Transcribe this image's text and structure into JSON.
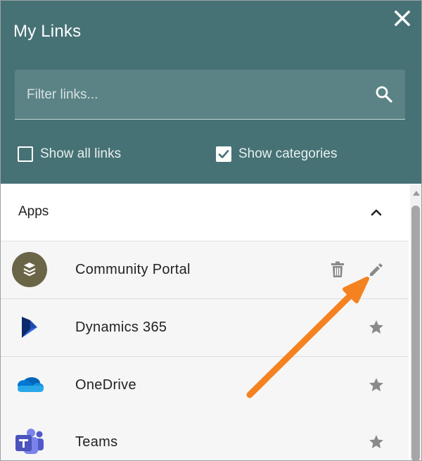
{
  "panel": {
    "title": "My Links",
    "close_icon": "close-icon",
    "header_color": "#467275"
  },
  "search": {
    "placeholder": "Filter links...",
    "value": "",
    "icon": "search-icon"
  },
  "options": {
    "show_all_links": {
      "label": "Show all links",
      "checked": false
    },
    "show_categories": {
      "label": "Show categories",
      "checked": true
    }
  },
  "category": {
    "label": "Apps",
    "expanded": true,
    "chevron_icon": "chevron-up-icon"
  },
  "links": [
    {
      "name": "Community Portal",
      "icon": "layers-icon",
      "actions": [
        "trash-icon",
        "pencil-icon"
      ]
    },
    {
      "name": "Dynamics 365",
      "icon": "dynamics-365-icon",
      "actions": [
        "star-icon"
      ]
    },
    {
      "name": "OneDrive",
      "icon": "onedrive-cloud-icon",
      "actions": [
        "star-icon"
      ]
    },
    {
      "name": "Teams",
      "icon": "teams-icon",
      "actions": [
        "star-icon"
      ]
    }
  ],
  "annotation": {
    "type": "arrow",
    "color": "#f58220",
    "points_to": "pencil-icon"
  }
}
